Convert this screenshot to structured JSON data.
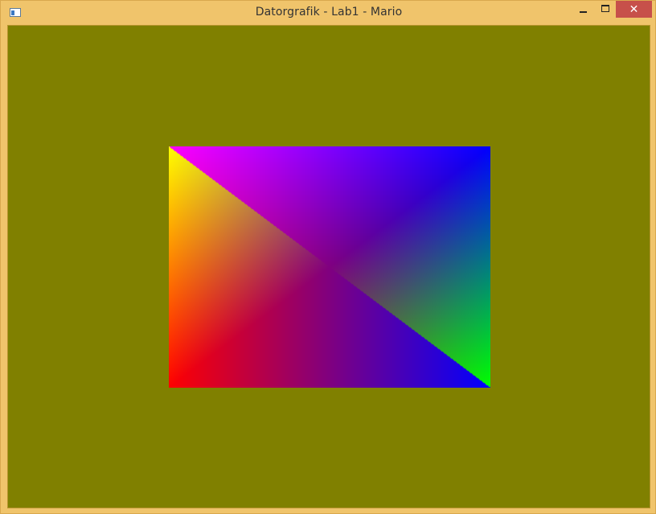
{
  "window": {
    "title": "Datorgrafik - Lab1 - Mario",
    "controls": {
      "minimize_icon": "minimize-icon",
      "maximize_icon": "maximize-icon",
      "close_icon": "close-icon",
      "close_glyph": "✕"
    }
  },
  "canvas": {
    "clear_color": "#808000",
    "quad": {
      "corner_colors": {
        "top_left": "#ffff00",
        "top_right": "#0000ff",
        "bottom_left": "#ff0000",
        "bottom_right": "#00ff00"
      }
    }
  },
  "colors": {
    "frame": "#f0c46b",
    "close_button": "#c7504a"
  }
}
